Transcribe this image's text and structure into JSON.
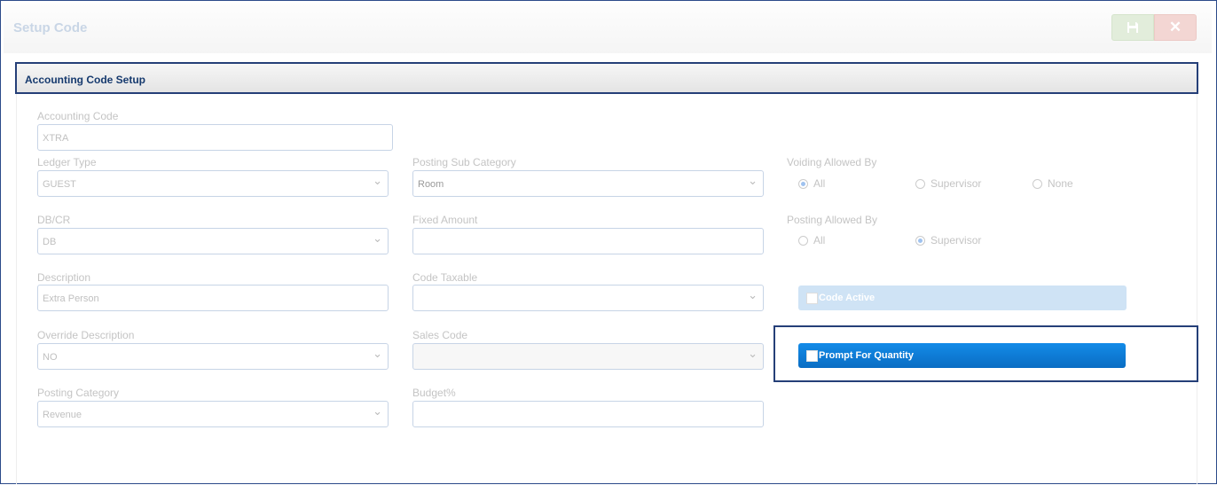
{
  "header": {
    "title": "Setup Code",
    "save_icon": "save-icon",
    "close_icon": "close-icon",
    "close_glyph": "✕",
    "save_glyph": "💾"
  },
  "section": {
    "title": "Accounting Code Setup"
  },
  "fields": {
    "accounting_code": {
      "label": "Accounting Code",
      "value": "XTRA"
    },
    "ledger_type": {
      "label": "Ledger Type",
      "value": "GUEST"
    },
    "db_cr": {
      "label": "DB/CR",
      "value": "DB"
    },
    "description": {
      "label": "Description",
      "value": "Extra Person"
    },
    "override_description": {
      "label": "Override Description",
      "value": "NO"
    },
    "posting_category": {
      "label": "Posting Category",
      "value": "Revenue"
    },
    "posting_sub_category": {
      "label": "Posting Sub Category",
      "value": "Room"
    },
    "fixed_amount": {
      "label": "Fixed Amount",
      "value": ""
    },
    "code_taxable": {
      "label": "Code Taxable",
      "value": ""
    },
    "sales_code": {
      "label": "Sales Code",
      "value": ""
    },
    "budget": {
      "label": "Budget%",
      "value": ""
    }
  },
  "voiding": {
    "label": "Voiding Allowed By",
    "options": [
      "All",
      "Supervisor",
      "None"
    ],
    "selected": "All"
  },
  "posting": {
    "label": "Posting Allowed By",
    "options": [
      "All",
      "Supervisor"
    ],
    "selected": "Supervisor"
  },
  "code_active": {
    "label": "Code Active",
    "checked": false
  },
  "prompt_quantity": {
    "label": "Prompt For Quantity",
    "checked": false
  }
}
